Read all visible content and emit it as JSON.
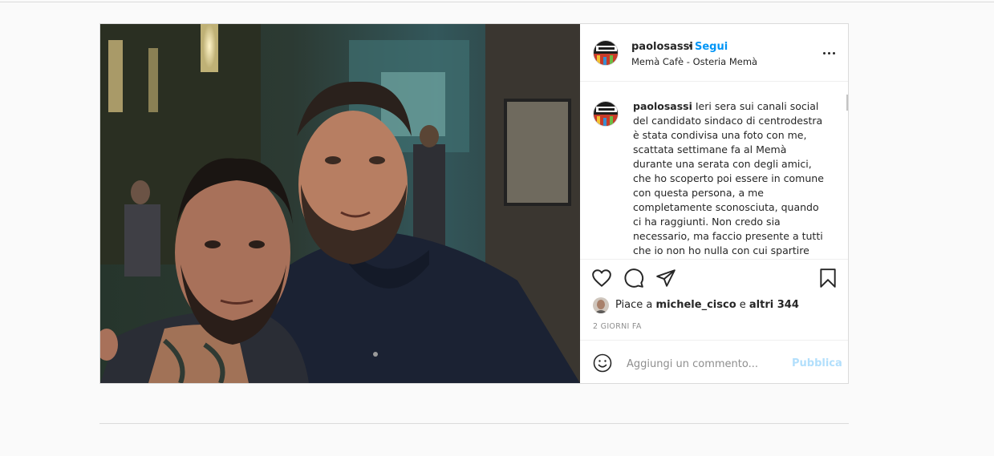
{
  "header": {
    "username": "paolosassi",
    "dot": "•",
    "follow_label": "Segui",
    "location": "Memà Cafè - Osteria Memà"
  },
  "caption": {
    "username": "paolosassi",
    "text": "Ieri sera sui canali social del candidato sindaco di centrodestra è stata condivisa una foto con me, scattata settimane fa al Memà durante una serata con degli amici, che ho scoperto poi essere in comune con questa persona, a me completamente sconosciuta, quando ci ha raggiunti. Non credo sia necessario, ma faccio presente a tutti che io non ho nulla con cui spartire con nessuna forza"
  },
  "likes": {
    "prefix": "Piace a",
    "user": "michele_cisco",
    "connector": "e",
    "others": "altri 344"
  },
  "time_label": "2 GIORNI FA",
  "comment": {
    "placeholder": "Aggiungi un commento...",
    "publish_label": "Pubblica"
  },
  "icons": {
    "like": "heart-icon",
    "comment": "comment-icon",
    "share": "share-icon",
    "save": "bookmark-icon",
    "emoji": "emoji-icon",
    "more": "more-options-icon"
  },
  "colors": {
    "link_blue": "#0095f6",
    "publish_disabled": "#b2dffc",
    "text": "#262626",
    "muted": "#8e8e8e"
  }
}
